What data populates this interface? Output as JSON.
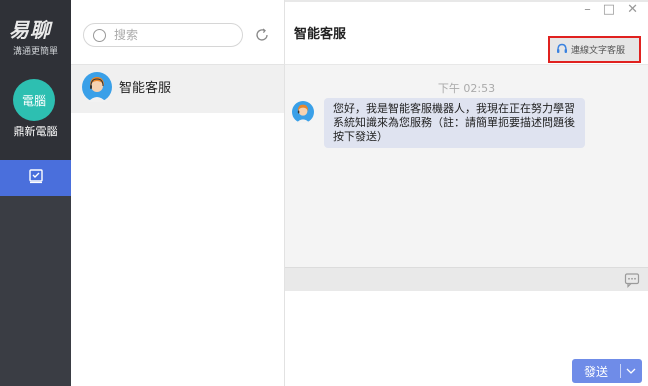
{
  "app": {
    "logo_text": "易聊",
    "logo_sub": "溝通更簡單"
  },
  "device": {
    "avatar_text": "電腦",
    "name": "鼎新電腦"
  },
  "search": {
    "placeholder": "搜索"
  },
  "contacts": [
    {
      "name": "智能客服"
    }
  ],
  "chat": {
    "title": "智能客服",
    "human_button_label": "連線文字客服",
    "messages": [
      {
        "time": "下午 02:53",
        "text": "您好，我是智能客服機器人，我現在正在努力學習系統知識來為您服務（註：請簡單扼要描述問題後按下發送）"
      }
    ]
  },
  "window_controls": {
    "minimize": "–",
    "maximize": "□",
    "close": "✕"
  },
  "composer": {
    "send_label": "發送"
  },
  "colors": {
    "rail_bg": "#3a3d44",
    "rail_active": "#4a6fdc",
    "avatar_teal": "#2dbfb1",
    "send_button": "#6f8ce8",
    "bubble_bg": "#dfe3f0",
    "highlight_border": "#e0211f"
  },
  "icons": [
    "search-icon",
    "refresh-icon",
    "chat-nav-icon",
    "headset-icon",
    "comment-icon",
    "chevron-down-icon",
    "agent-avatar-icon"
  ]
}
